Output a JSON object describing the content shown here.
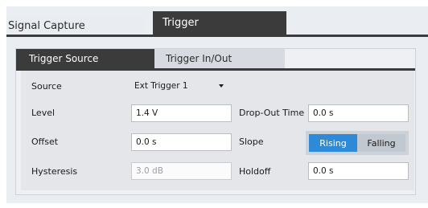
{
  "tabs": {
    "outer": [
      {
        "label": "Signal Capture",
        "active": false
      },
      {
        "label": "Trigger",
        "active": true
      }
    ],
    "inner": [
      {
        "label": "Trigger Source",
        "active": true
      },
      {
        "label": "Trigger In/Out",
        "active": false
      }
    ]
  },
  "form": {
    "source_label": "Source",
    "source_value": "Ext Trigger 1",
    "level_label": "Level",
    "level_value": "1.4 V",
    "offset_label": "Offset",
    "offset_value": "0.0 s",
    "hysteresis_label": "Hysteresis",
    "hysteresis_value": "3.0 dB",
    "dropout_label": "Drop-Out Time",
    "dropout_value": "0.0 s",
    "slope_label": "Slope",
    "slope_options": [
      "Rising",
      "Falling"
    ],
    "slope_selected": "Rising",
    "holdoff_label": "Holdoff",
    "holdoff_value": "0.0 s"
  },
  "colors": {
    "active_tab": "#3b3b3b",
    "selected_segment": "#2e8ad6"
  }
}
